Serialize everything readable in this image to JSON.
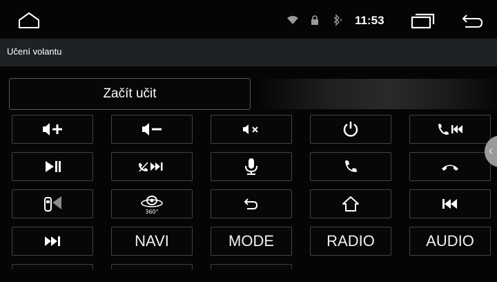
{
  "status_bar": {
    "time": "11:53",
    "icons": [
      "home-icon",
      "wifi-icon",
      "lock-icon",
      "bluetooth-icon",
      "recent-apps-icon",
      "back-icon"
    ]
  },
  "header": {
    "title": "Učení volantu"
  },
  "actions": {
    "start_label": "Začít učit"
  },
  "keys": {
    "navi": "NAVI",
    "mode": "MODE",
    "radio": "RADIO",
    "audio": "AUDIO",
    "camera_badge": "360°"
  },
  "side_tab": {
    "glyph": "‹"
  },
  "colors": {
    "background": "#050505",
    "title_bar": "#1e2226",
    "key_border": "#444444",
    "accent": "#ffffff"
  }
}
